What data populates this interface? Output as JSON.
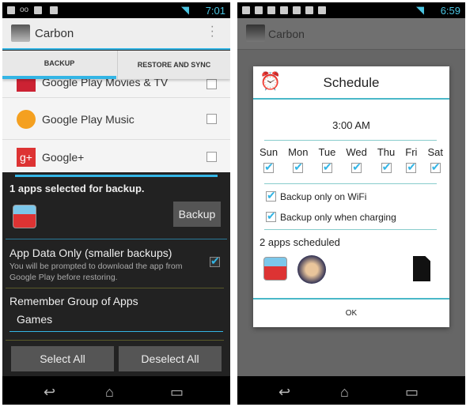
{
  "left": {
    "status_time": "7:01",
    "app_title": "Carbon",
    "tabs": [
      {
        "label": "BACKUP",
        "active": true
      },
      {
        "label": "RESTORE AND SYNC",
        "active": false
      }
    ],
    "apps": [
      {
        "name": "Google Play Movies & TV",
        "checked": false
      },
      {
        "name": "Google Play Music",
        "checked": false
      },
      {
        "name": "Google+",
        "checked": false
      }
    ],
    "selected_text": "1 apps selected for backup.",
    "backup_button": "Backup",
    "app_data_title": "App Data Only (smaller backups)",
    "app_data_desc": "You will be prompted to download the app from Google Play before restoring.",
    "app_data_checked": true,
    "remember_label": "Remember Group of Apps",
    "group_value": "Games",
    "select_all": "Select All",
    "deselect_all": "Deselect All"
  },
  "right": {
    "status_time": "6:59",
    "app_title": "Carbon",
    "dialog": {
      "title": "Schedule",
      "time": "3:00 AM",
      "days": [
        {
          "label": "Sun",
          "checked": true
        },
        {
          "label": "Mon",
          "checked": true
        },
        {
          "label": "Tue",
          "checked": true
        },
        {
          "label": "Wed",
          "checked": true
        },
        {
          "label": "Thu",
          "checked": true
        },
        {
          "label": "Fri",
          "checked": true
        },
        {
          "label": "Sat",
          "checked": true
        }
      ],
      "wifi_label": "Backup only on WiFi",
      "wifi_checked": true,
      "charging_label": "Backup only when charging",
      "charging_checked": true,
      "apps_scheduled": "2 apps scheduled",
      "ok": "OK"
    }
  },
  "colors": {
    "accent": "#33b5e5",
    "dark_bg": "#222222",
    "divider_olive": "#5a5a2a"
  }
}
